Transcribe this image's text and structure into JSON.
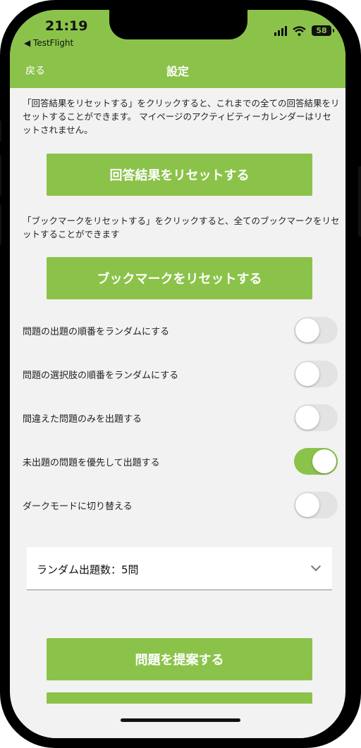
{
  "status_bar": {
    "time": "21:19",
    "back_app": "◀ TestFlight",
    "battery": "58"
  },
  "nav": {
    "back_label": "戻る",
    "title": "設定"
  },
  "reset_answers": {
    "description": "「回答結果をリセットする」をクリックすると、これまでの全ての回答結果をリセットすることができます。 マイページのアクティビティーカレンダーはリセットされません。",
    "button_label": "回答結果をリセットする"
  },
  "reset_bookmarks": {
    "description": "「ブックマークをリセットする」をクリックすると、全てのブックマークをリセットすることができます",
    "button_label": "ブックマークをリセットする"
  },
  "toggles": [
    {
      "label": "問題の出題の順番をランダムにする",
      "on": false
    },
    {
      "label": "問題の選択肢の順番をランダムにする",
      "on": false
    },
    {
      "label": "間違えた問題のみを出題する",
      "on": false
    },
    {
      "label": "未出題の問題を優先して出題する",
      "on": true
    },
    {
      "label": "ダークモードに切り替える",
      "on": false
    }
  ],
  "random_count_select": {
    "value": "ランダム出題数：5問"
  },
  "suggest": {
    "button_label": "問題を提案する"
  },
  "colors": {
    "accent": "#8bc34a",
    "toggle_off": "#e3e3e3",
    "background": "#f2f2f2"
  }
}
